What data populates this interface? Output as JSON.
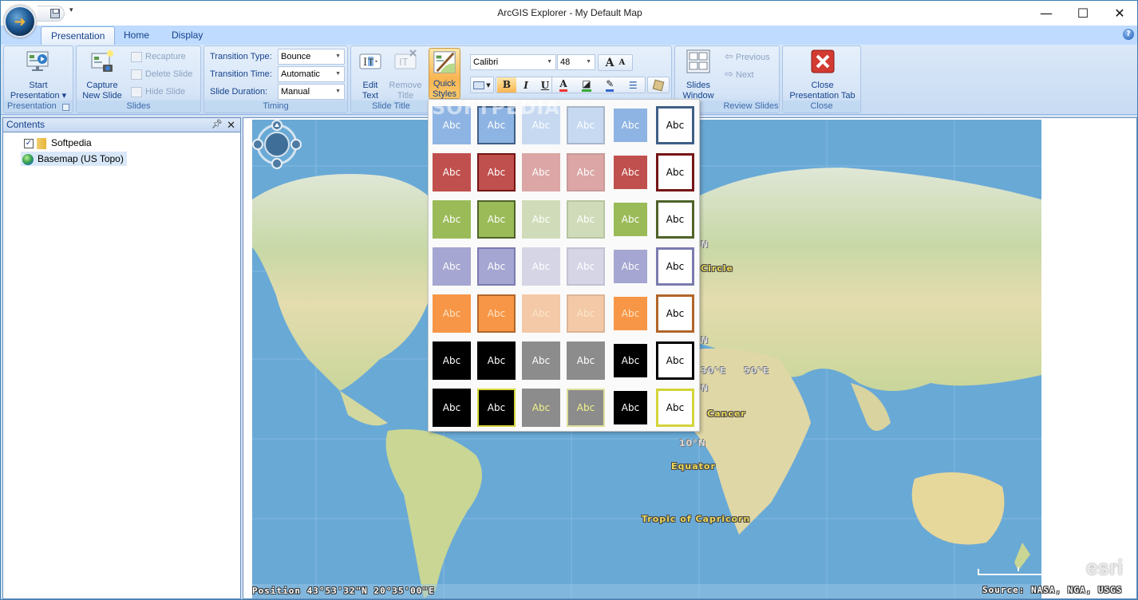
{
  "window": {
    "title": "ArcGIS Explorer - My Default Map",
    "min_glyph": "—",
    "max_glyph": "☐",
    "close_glyph": "✕",
    "qat_more_glyph": "▾"
  },
  "tabs": [
    {
      "label": "Presentation",
      "active": true
    },
    {
      "label": "Home",
      "active": false
    },
    {
      "label": "Display",
      "active": false
    }
  ],
  "help_glyph": "?",
  "ribbon": {
    "presentation_group": {
      "label": "Presentation",
      "start_line1": "Start",
      "start_line2": "Presentation ▾"
    },
    "slides_group": {
      "label": "Slides",
      "capture_line1": "Capture",
      "capture_line2": "New Slide",
      "recapture": "Recapture",
      "delete_slide": "Delete Slide",
      "hide_slide": "Hide Slide"
    },
    "timing_group": {
      "label": "Timing",
      "transition_type_label": "Transition Type:",
      "transition_type_value": "Bounce",
      "transition_time_label": "Transition Time:",
      "transition_time_value": "Automatic",
      "slide_duration_label": "Slide Duration:",
      "slide_duration_value": "Manual"
    },
    "slide_title_group": {
      "label": "Slide Title",
      "edit_line1": "Edit",
      "edit_line2": "Text",
      "remove_line1": "Remove",
      "remove_line2": "Title",
      "quick_line1": "Quick",
      "quick_line2": "Styles ▾"
    },
    "font": {
      "family": "Calibri",
      "size": "48",
      "grow": "A",
      "shrink": "A",
      "bold": "B",
      "italic": "I",
      "underline": "U",
      "font_color": "A"
    },
    "review_group": {
      "label": "Review Slides",
      "slides_window_line1": "Slides",
      "slides_window_line2": "Window",
      "previous": "Previous",
      "next": "Next"
    },
    "close_group": {
      "label": "Close",
      "close_line1": "Close",
      "close_line2": "Presentation Tab"
    }
  },
  "contents": {
    "title": "Contents",
    "pin_glyph": "⊥",
    "close_glyph": "✕",
    "items": [
      {
        "label": "Softpedia",
        "checked": true,
        "type": "folder"
      },
      {
        "label": "Basemap (US Topo)",
        "type": "basemap",
        "selected": true
      }
    ]
  },
  "quick_styles": {
    "sample_text": "Abc",
    "rows": [
      {
        "name": "blue",
        "fill": "#8eb4e3",
        "light": "#c6d9f1",
        "border": "#3f5f86",
        "light_border": "#a8b6c8"
      },
      {
        "name": "red",
        "fill": "#c0504d",
        "light": "#dba6a5",
        "border": "#751515",
        "light_border": "#c89a99"
      },
      {
        "name": "green",
        "fill": "#9bbb59",
        "light": "#d0dcb9",
        "border": "#4f6228",
        "light_border": "#b6c4a0"
      },
      {
        "name": "purple",
        "fill": "#a6a6d2",
        "light": "#d5d5e6",
        "border": "#7b7bb0",
        "light_border": "#c2c2d6"
      },
      {
        "name": "orange",
        "fill": "#f79646",
        "light": "#f3c9a8",
        "border": "#b2652a",
        "light_border": "#dcb597"
      },
      {
        "name": "black",
        "fill": "#000000",
        "light": "#8c8c8c",
        "border": "#000000",
        "light_border": "#8c8c8c"
      },
      {
        "name": "black-yellow",
        "fill": "#000000",
        "light": "#8c8c8c",
        "border": "#d4d43a",
        "light_border": "#dede9c"
      }
    ]
  },
  "map": {
    "labels": {
      "arctic_circle": "Circle",
      "tropic_cancer": "Cancer",
      "equator": "Equator",
      "tropic_capricorn": "Tropic of Capricorn",
      "lon_30": "30°E",
      "lon_50": "50°E",
      "lat_10": "10°N",
      "n1": "N",
      "n2": "N",
      "n3": "N"
    },
    "position_readout": "Position 43°53'32\"N  20°35'00\"E",
    "source": "Source: NASA, NGA, USGS",
    "logo": "esri"
  },
  "watermark": "SOFTPEDIA"
}
